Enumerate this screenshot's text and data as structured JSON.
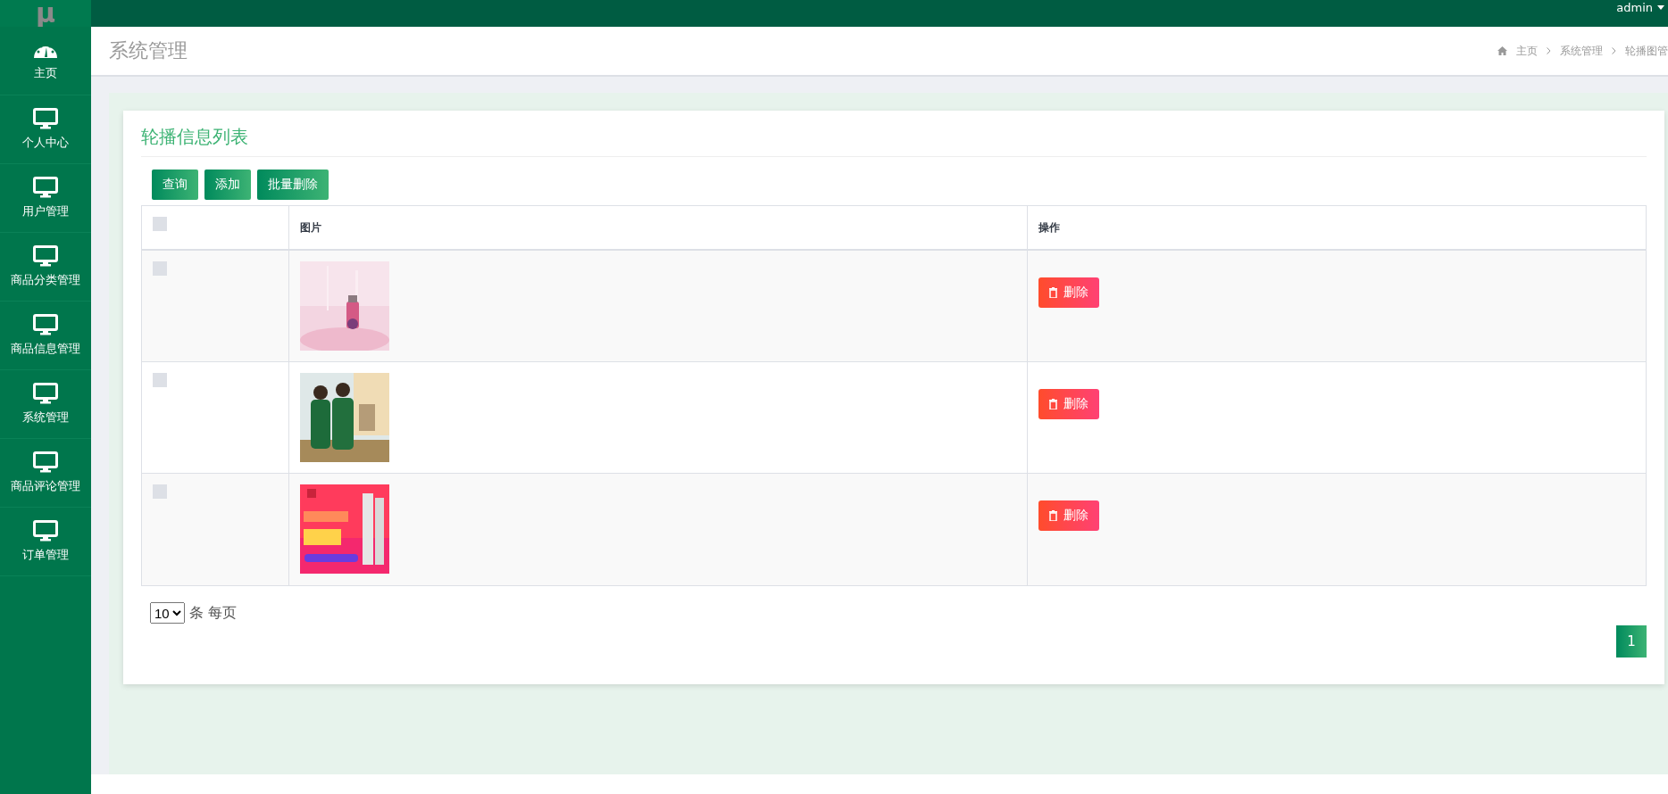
{
  "logo": "μ",
  "top_bar": {
    "user": "admin"
  },
  "sidebar": {
    "items": [
      {
        "label": "主页",
        "selected": false
      },
      {
        "label": "个人中心",
        "selected": false
      },
      {
        "label": "用户管理",
        "selected": false
      },
      {
        "label": "商品分类管理",
        "selected": false
      },
      {
        "label": "商品信息管理",
        "selected": false
      },
      {
        "label": "系统管理",
        "selected": false
      },
      {
        "label": "商品评论管理",
        "selected": false
      },
      {
        "label": "订单管理",
        "selected": false
      }
    ]
  },
  "page_header": {
    "title": "系统管理",
    "breadcrumb": [
      "主页",
      "系统管理",
      "轮播图管"
    ]
  },
  "card": {
    "title": "轮播信息列表",
    "toolbar": [
      "查询",
      "添加",
      "批量删除"
    ],
    "table": {
      "select_all": {
        "checked": false
      },
      "columns": [
        "图片",
        "操作"
      ],
      "rows": [
        {
          "checked": false,
          "action": "删除"
        },
        {
          "checked": false,
          "action": "删除"
        },
        {
          "checked": false,
          "action": "删除"
        }
      ]
    },
    "page_size": {
      "value": "10",
      "suffix": "条 每页"
    },
    "pages": [
      {
        "label": "1",
        "selected": true
      }
    ]
  }
}
